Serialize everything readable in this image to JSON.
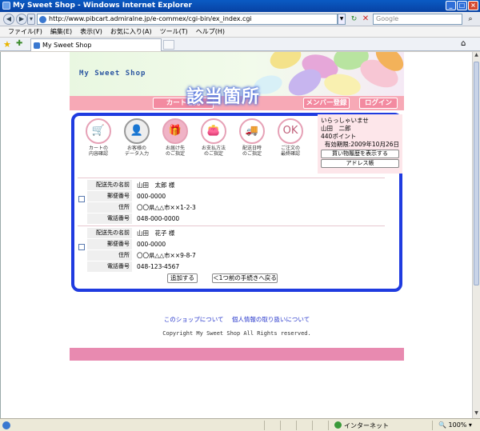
{
  "window": {
    "title": "My Sweet Shop - Windows Internet Explorer",
    "controls": [
      "_",
      "□",
      "×"
    ]
  },
  "address_bar": {
    "url": "http://www.pibcart.admiralne.jp/e-commex/cgi-bin/ex_index.cgi",
    "search_placeholder": "Google"
  },
  "menu": {
    "items": [
      "ファイル(F)",
      "編集(E)",
      "表示(V)",
      "お気に入り(A)",
      "ツール(T)",
      "ヘルプ(H)"
    ]
  },
  "tabs": [
    {
      "label": "My Sweet Shop"
    }
  ],
  "shop": {
    "title": "My Sweet Shop",
    "nav": [
      {
        "label": "カートを見"
      },
      {
        "label": "メンバー登録"
      },
      {
        "label": "ログイン"
      }
    ],
    "caption": "該当箇所",
    "steps": [
      {
        "label1": "カートの",
        "label2": "内容確認",
        "state": "normal"
      },
      {
        "label1": "お客様の",
        "label2": "データ入力",
        "state": "done"
      },
      {
        "label1": "お届け先",
        "label2": "のご指定",
        "state": "active"
      },
      {
        "label1": "お支払方法",
        "label2": "のご指定",
        "state": "normal"
      },
      {
        "label1": "配送日時",
        "label2": "のご指定",
        "state": "normal"
      },
      {
        "label1": "ご注文の",
        "label2": "最終確認",
        "state": "normal"
      }
    ],
    "user": {
      "greeting": "いらっしゃいませ",
      "name": "山田　二郎",
      "points": "440ポイント",
      "expiry": "有効期限:2009年10月26日",
      "history_button": "買い物履歴を表示する",
      "address_button": "アドレス帳"
    },
    "addresses": [
      {
        "labels": [
          "配送先の名前",
          "郵便番号",
          "住所",
          "電話番号"
        ],
        "name": "山田　太郎 様",
        "zip": "000-0000",
        "address": "〇〇県△△市××1-2-3",
        "phone": "048-000-0000"
      },
      {
        "labels": [
          "配送先の名前",
          "郵便番号",
          "住所",
          "電話番号"
        ],
        "name": "山田　花子 様",
        "zip": "000-0000",
        "address": "〇〇県△△市××9-8-7",
        "phone": "048-123-4567"
      }
    ],
    "add_button": "追加する",
    "back_button": "＜1つ前の手続きへ戻る",
    "footer_links": [
      "このショップについて",
      "個人情報の取り扱いについて"
    ],
    "copyright": "Copyright My Sweet Shop All Rights reserved."
  },
  "status": {
    "zone": "インターネット",
    "zoom": "100%"
  },
  "colors": {
    "frame": "#1f3be0",
    "nav_pink": "#f38aa0",
    "band_pink": "#e88ab0"
  }
}
